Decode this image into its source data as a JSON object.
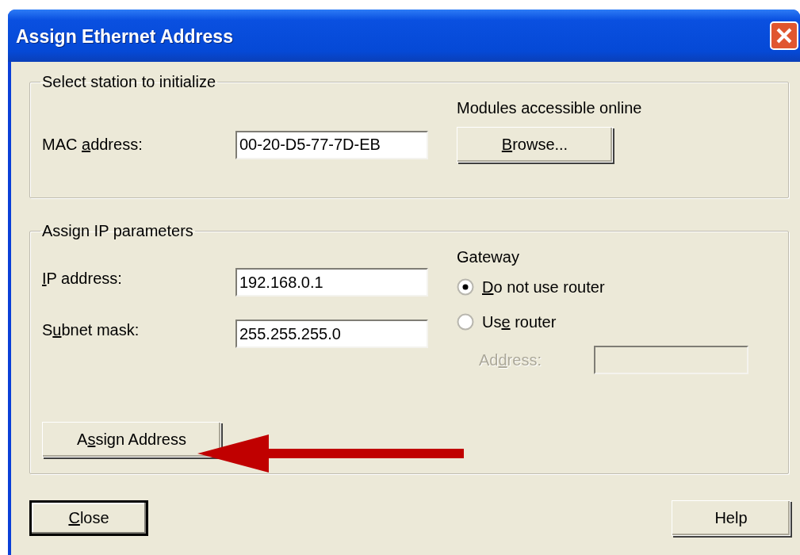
{
  "window": {
    "title": "Assign Ethernet Address"
  },
  "station_group": {
    "legend": "Select station to initialize",
    "mac": {
      "label": {
        "pre": "MAC ",
        "key": "a",
        "post": "ddress:"
      },
      "value": "00-20-D5-77-7D-EB"
    },
    "online_label": "Modules accessible online",
    "browse_button": {
      "key": "B",
      "post": "rowse..."
    }
  },
  "ip_group": {
    "legend": "Assign IP parameters",
    "fields": [
      {
        "label": {
          "key": "I",
          "post": "P address:"
        },
        "value": "192.168.0.1"
      },
      {
        "label": {
          "pre": "S",
          "key": "u",
          "post": "bnet mask:"
        },
        "value": "255.255.255.0"
      }
    ],
    "gateway": {
      "heading": "Gateway",
      "options": [
        {
          "label": {
            "key": "D",
            "post": "o not use router"
          },
          "selected": true
        },
        {
          "label": {
            "pre": "Us",
            "key": "e",
            "post": " router"
          },
          "selected": false
        }
      ],
      "address": {
        "label": {
          "pre": "Ad",
          "key": "d",
          "post": "ress:"
        },
        "disabled": true
      }
    },
    "assign_button": {
      "pre": "A",
      "key": "s",
      "post": "sign Address"
    }
  },
  "buttons": [
    {
      "label": {
        "key": "C",
        "post": "lose"
      },
      "default": true
    },
    {
      "label": {
        "pre": "Help"
      },
      "default": false
    }
  ]
}
